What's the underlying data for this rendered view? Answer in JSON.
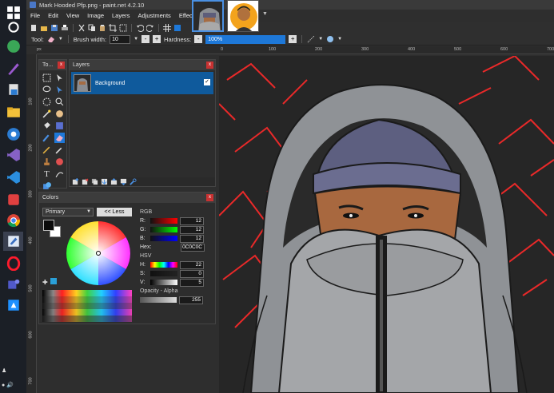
{
  "app": {
    "title": "Mark Hooded Pfp.png - paint.net 4.2.10",
    "menu": [
      "File",
      "Edit",
      "View",
      "Image",
      "Layers",
      "Adjustments",
      "Effects"
    ]
  },
  "toolbar": {
    "tool_label": "Tool:",
    "brush_width_label": "Brush width:",
    "brush_width_value": "10",
    "hardness_label": "Hardness:",
    "hardness_value": "100%"
  },
  "rulers": {
    "top": [
      "px",
      "0",
      "100",
      "200",
      "300",
      "400",
      "500",
      "600",
      "700"
    ],
    "left": [
      "100",
      "200",
      "300",
      "400",
      "500",
      "600",
      "700"
    ]
  },
  "tools_panel": {
    "title": "To..."
  },
  "layers_panel": {
    "title": "Layers",
    "layers": [
      {
        "name": "Background",
        "visible": true
      }
    ]
  },
  "colors_panel": {
    "title": "Colors",
    "mode": "Primary",
    "less_button": "<< Less",
    "rgb_label": "RGB",
    "r_label": "R:",
    "r_value": "12",
    "g_label": "G:",
    "g_value": "12",
    "b_label": "B:",
    "b_value": "12",
    "hex_label": "Hex:",
    "hex_value": "0C0C0C",
    "hsv_label": "HSV",
    "h_label": "H:",
    "h_value": "22",
    "s_label": "S:",
    "s_value": "0",
    "v_label": "V:",
    "v_value": "5",
    "opacity_label": "Opacity - Alpha",
    "opacity_value": "255"
  },
  "colors": {
    "accent": "#1e78d8",
    "layer_selected": "#0f5a9c",
    "close": "#c83232",
    "glow": "#ff2020"
  }
}
